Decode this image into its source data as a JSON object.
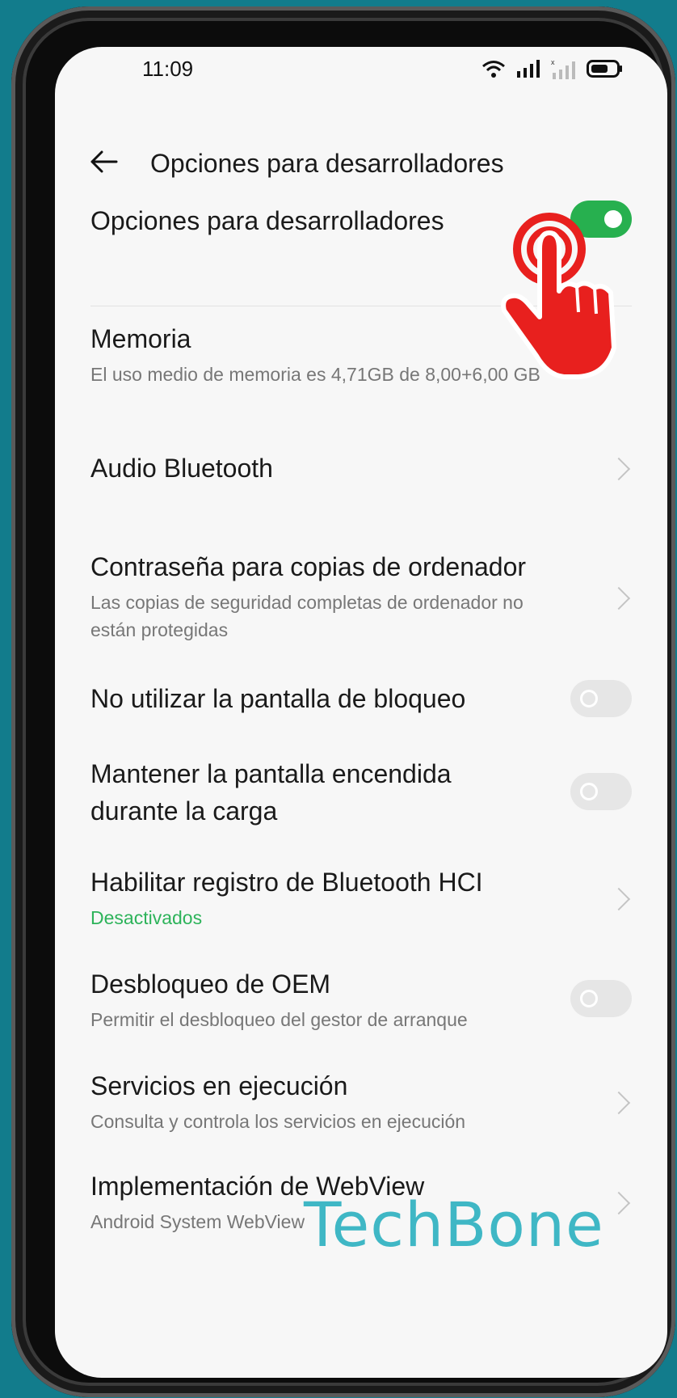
{
  "status_bar": {
    "time": "11:09"
  },
  "header": {
    "title": "Opciones para desarrolladores"
  },
  "items": [
    {
      "title": "Opciones para desarrolladores",
      "subtitle": "",
      "control": "toggle",
      "on": true
    },
    {
      "title": "Memoria",
      "subtitle": "El uso medio de memoria es 4,71GB de 8,00+6,00 GB",
      "control": "none"
    },
    {
      "title": "Audio Bluetooth",
      "subtitle": "",
      "control": "chevron"
    },
    {
      "title": "Contraseña para copias de ordenador",
      "subtitle": "Las copias de seguridad completas de ordenador no están protegidas",
      "control": "chevron"
    },
    {
      "title": "No utilizar la pantalla de bloqueo",
      "subtitle": "",
      "control": "toggle",
      "on": false
    },
    {
      "title": "Mantener la pantalla encendida durante la carga",
      "subtitle": "",
      "control": "toggle",
      "on": false
    },
    {
      "title": "Habilitar registro de Bluetooth HCI",
      "subtitle": "Desactivados",
      "control": "chevron",
      "subtitle_color": "#2db35a"
    },
    {
      "title": "Desbloqueo de OEM",
      "subtitle": "Permitir el desbloqueo del gestor de arranque",
      "control": "toggle",
      "on": false
    },
    {
      "title": "Servicios en ejecución",
      "subtitle": "Consulta y controla los servicios en ejecución",
      "control": "chevron"
    },
    {
      "title": "Implementación de WebView",
      "subtitle": "Android System WebView",
      "control": "chevron"
    }
  ],
  "watermark": {
    "text": "TechBone"
  },
  "colors": {
    "accent_green": "#27b04f",
    "background": "#127c8c",
    "tap_hand": "#e8201e",
    "watermark": "#3fb7c5"
  },
  "icons": [
    "back-arrow-icon",
    "wifi-icon",
    "signal-icon",
    "signal-no-sim-icon",
    "battery-icon",
    "tap-hand-icon",
    "chevron-right-icon"
  ]
}
